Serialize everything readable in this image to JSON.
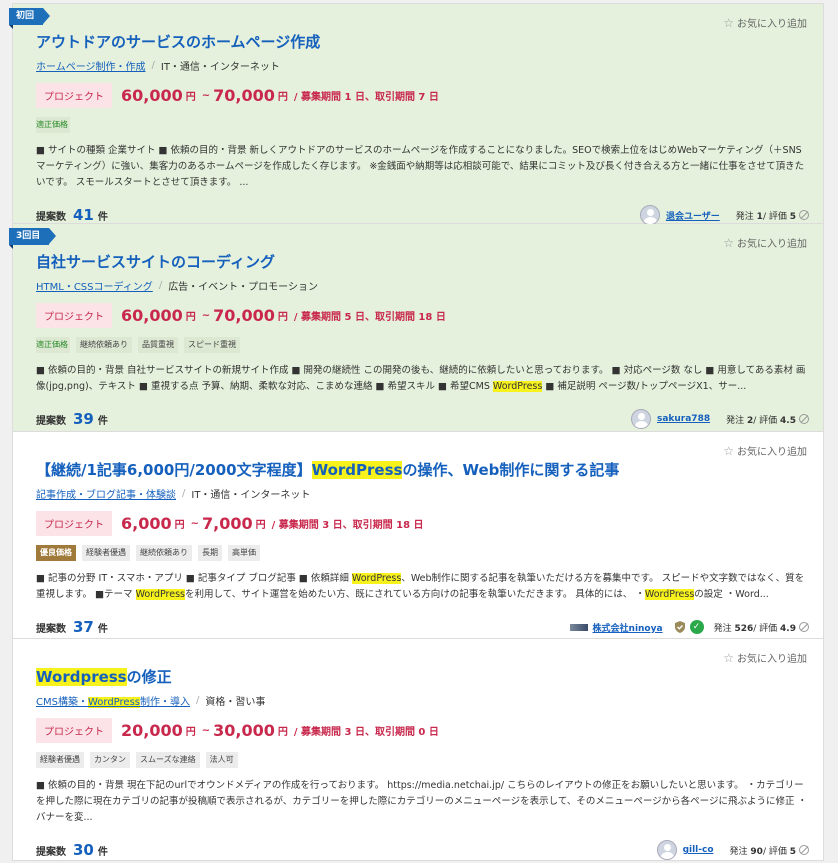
{
  "fav_label": "お気に入り追加",
  "proposals_label": "提案数",
  "proposals_unit": "件",
  "project_label": "プロジェクト",
  "order_label": "発注",
  "rating_label": "評価",
  "jobs": [
    {
      "ribbon": "初回",
      "title": "アウトドアのサービスのホームページ作成",
      "category_link": "ホームページ制作・作成",
      "category_plain": "IT・通信・インターネット",
      "price_min": "60,000",
      "price_max": "70,000",
      "yen": "円",
      "tilde": "~",
      "period": "/ 募集期間 1 日、取引期間 7 日",
      "tags": [
        "適正価格"
      ],
      "description": "■ サイトの種類 企業サイト ■ 依頼の目的・背景 新しくアウトドアのサービスのホームページを作成することになりました。SEOで検索上位をはじめWebマーケティング（＋SNSマーケティング）に強い、集客力のあるホームページを作成したく存じます。 ※金銭面や納期等は応相談可能で、結果にコミット及び長く付き合える方と一緒に仕事をさせて頂きたいです。 スモールスタートとさせて頂きます。 ...",
      "proposals": "41",
      "client": "退会ユーザー",
      "orders": "1",
      "rating": "5"
    },
    {
      "ribbon": "3回目",
      "title": "自社サービスサイトのコーディング",
      "category_link": "HTML・CSSコーディング",
      "category_plain": "広告・イベント・プロモーション",
      "price_min": "60,000",
      "price_max": "70,000",
      "yen": "円",
      "tilde": "~",
      "period": "/ 募集期間 5 日、取引期間 18 日",
      "tags": [
        "適正価格",
        "継続依頼あり",
        "品質重視",
        "スピード重視"
      ],
      "desc_a": "■ 依頼の目的・背景 自社サービスサイトの新規サイト作成 ■ 開発の継続性 この開発の後も、継続的に依頼したいと思っております。 ■ 対応ページ数 なし ■ 用意してある素材 画像(jpg,png)、テキスト ■ 重視する点 予算、納期、柔軟な対応、こまめな連絡 ■ 希望スキル ■ 希望CMS ",
      "desc_hl": "WordPress",
      "desc_b": " ■ 補足説明 ページ数/トップページX1、サー...",
      "proposals": "39",
      "client": "sakura788",
      "orders": "2",
      "rating": "4.5"
    },
    {
      "title_a": "【継続/1記事6,000円/2000文字程度】",
      "title_hl": "WordPress",
      "title_b": "の操作、Web制作に関する記事",
      "category_link": "記事作成・ブログ記事・体験談",
      "category_plain": "IT・通信・インターネット",
      "price_min": "6,000",
      "price_max": "7,000",
      "yen": "円",
      "tilde": "~",
      "period": "/ 募集期間 3 日、取引期間 18 日",
      "tags": [
        "優良価格",
        "経験者優遇",
        "継続依頼あり",
        "長期",
        "高単価"
      ],
      "desc_a": "■ 記事の分野 IT・スマホ・アプリ ■ 記事タイプ ブログ記事 ■ 依頼詳細 ",
      "desc_hl1": "WordPress",
      "desc_b": "、Web制作に関する記事を執筆いただける方を募集中です。 スピードや文字数ではなく、質を重視します。 ■テーマ ",
      "desc_hl2": "WordPress",
      "desc_c": "を利用して、サイト運営を始めたい方、既にされている方向けの記事を執筆いただきます。 具体的には、 ・",
      "desc_hl3": "WordPress",
      "desc_d": "の設定 ・Word...",
      "proposals": "37",
      "client": "株式会社ninoya",
      "orders": "526",
      "rating": "4.9"
    },
    {
      "title_hl": "Wordpress",
      "title_b": "の修正",
      "category_link_a": "CMS構築・",
      "category_link_hl": "WordPress",
      "category_link_b": "制作・導入",
      "category_plain": "資格・習い事",
      "price_min": "20,000",
      "price_max": "30,000",
      "yen": "円",
      "tilde": "~",
      "period": "/ 募集期間 3 日、取引期間 0 日",
      "tags": [
        "経験者優遇",
        "カンタン",
        "スムーズな連絡",
        "法人可"
      ],
      "description": "■ 依頼の目的・背景 現在下記のurlでオウンドメディアの作成を行っております。 https://media.netchai.jp/ こちらのレイアウトの修正をお願いしたいと思います。 ・カテゴリーを押した際に現在カテゴリの記事が投稿順で表示されるが、カテゴリーを押した際にカテゴリーのメニューページを表示して、そのメニューページから各ページに飛ぶように修正 ・バナーを変...",
      "proposals": "30",
      "client": "gill-co",
      "orders": "90",
      "rating": "5"
    }
  ]
}
